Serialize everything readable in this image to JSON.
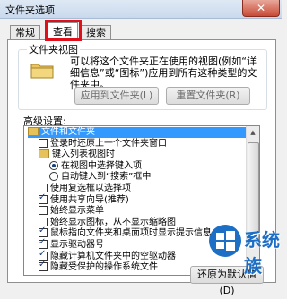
{
  "window": {
    "title": "文件夹选项",
    "close_glyph": "✕"
  },
  "tabs": [
    {
      "label": "常规"
    },
    {
      "label": "查看"
    },
    {
      "label": "搜索"
    }
  ],
  "folder_view": {
    "legend": "文件夹视图",
    "description": "可以将这个文件夹正在使用的视图(例如“详细信息”或“图标”)应用到所有这种类型的文件夹中。",
    "apply_label": "应用到文件夹(L)",
    "reset_label": "重置文件夹(R)"
  },
  "advanced": {
    "label": "高级设置:",
    "items": [
      {
        "text": "文件和文件夹",
        "type": "folder",
        "checked": false,
        "selected": true,
        "indent": 0
      },
      {
        "text": "登录时还原上一个文件夹窗口",
        "type": "checkbox",
        "checked": false,
        "indent": 1
      },
      {
        "text": "键入列表视图时",
        "type": "folder",
        "checked": false,
        "indent": 1
      },
      {
        "text": "在视图中选择键入项",
        "type": "radio",
        "checked": true,
        "indent": 2
      },
      {
        "text": "自动键入到“搜索”框中",
        "type": "radio",
        "checked": false,
        "indent": 2
      },
      {
        "text": "使用复选框以选择项",
        "type": "checkbox",
        "checked": false,
        "indent": 1
      },
      {
        "text": "使用共享向导(推荐)",
        "type": "checkbox",
        "checked": true,
        "indent": 1
      },
      {
        "text": "始终显示菜单",
        "type": "checkbox",
        "checked": false,
        "indent": 1
      },
      {
        "text": "始终显示图标，从不显示缩略图",
        "type": "checkbox",
        "checked": false,
        "indent": 1
      },
      {
        "text": "鼠标指向文件夹和桌面项时显示提示信息",
        "type": "checkbox",
        "checked": true,
        "indent": 1
      },
      {
        "text": "显示驱动器号",
        "type": "checkbox",
        "checked": true,
        "indent": 1
      },
      {
        "text": "隐藏计算机文件夹中的空驱动器",
        "type": "checkbox",
        "checked": true,
        "indent": 1
      },
      {
        "text": "隐藏受保护的操作系统文件",
        "type": "checkbox",
        "checked": true,
        "indent": 1
      }
    ],
    "restore_label": "还原为默认值(D)"
  },
  "watermark": {
    "text": "系统族"
  }
}
